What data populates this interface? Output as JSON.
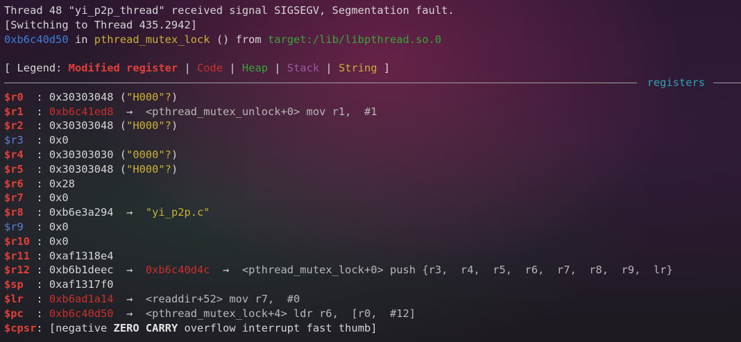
{
  "header": {
    "signal_line": "Thread 48 \"yi_p2p_thread\" received signal SIGSEGV, Segmentation fault.",
    "switch_line": "[Switching to Thread 435.2942]",
    "location": {
      "addr": "0xb6c40d50",
      "in": " in ",
      "func": "pthread_mutex_lock",
      "from": " () from ",
      "lib": "target:/lib/libpthread.so.0"
    }
  },
  "legend": {
    "open": "[ Legend: ",
    "modified": "Modified register",
    "code": "Code",
    "heap": "Heap",
    "stack": "Stack",
    "string": "String",
    "close": " ]"
  },
  "section": {
    "registers": "registers"
  },
  "registers": [
    {
      "name": "$r0 ",
      "rest": " : 0x30303048 (",
      "str": "\"H000\"?",
      "tail": ")"
    },
    {
      "name": "$r1 ",
      "sep": " : ",
      "val": "0xb6c41ed8",
      "arrow": "  →  ",
      "inst": "<pthread_mutex_unlock+0> mov r1,  #1"
    },
    {
      "name": "$r2 ",
      "rest": " : 0x30303048 (",
      "str": "\"H000\"?",
      "tail": ")"
    },
    {
      "name": "$r3 ",
      "rest": " : 0x0"
    },
    {
      "name": "$r4 ",
      "rest": " : 0x30303030 (",
      "str": "\"0000\"?",
      "tail": ")"
    },
    {
      "name": "$r5 ",
      "rest": " : 0x30303048 (",
      "str": "\"H000\"?",
      "tail": ")"
    },
    {
      "name": "$r6 ",
      "rest": " : 0x28"
    },
    {
      "name": "$r7 ",
      "rest": " : 0x0"
    },
    {
      "name": "$r8 ",
      "rest": " : 0xb6e3a294  →  ",
      "str": "\"yi_p2p.c\""
    },
    {
      "name": "$r9 ",
      "rest": " : 0x0"
    },
    {
      "name": "$r10",
      "rest": " : 0x0"
    },
    {
      "name": "$r11",
      "rest": " : 0xaf1318e4"
    },
    {
      "name": "$r12",
      "rest": " : 0xb6b1deec  →  ",
      "val": "0xb6c40d4c",
      "arrow": "  →  ",
      "inst": "<pthread_mutex_lock+0> push {r3,  r4,  r5,  r6,  r7,  r8,  r9,  lr}"
    },
    {
      "name": "$sp ",
      "rest": " : 0xaf1317f0"
    },
    {
      "name": "$lr ",
      "sep": " : ",
      "val": "0xb6ad1a14",
      "arrow": "  →  ",
      "inst": "<readdir+52> mov r7,  #0"
    },
    {
      "name": "$pc ",
      "sep": " : ",
      "val": "0xb6c40d50",
      "arrow": "  →  ",
      "inst": "<pthread_mutex_lock+4> ldr r6,  [r0,  #12]"
    },
    {
      "name": "$cpsr",
      "sep": ": [negative ",
      "zero": "ZERO",
      "sp": " ",
      "carry": "CARRY",
      "tail": " overflow interrupt fast thumb]"
    }
  ],
  "colors": {
    "modified": "#e0403a",
    "code": "#c9302c",
    "heap": "#3aa43a",
    "stack": "#9a58a8",
    "string": "#c9b035",
    "address": "#3f7fd6",
    "section": "#2fa0b4"
  }
}
